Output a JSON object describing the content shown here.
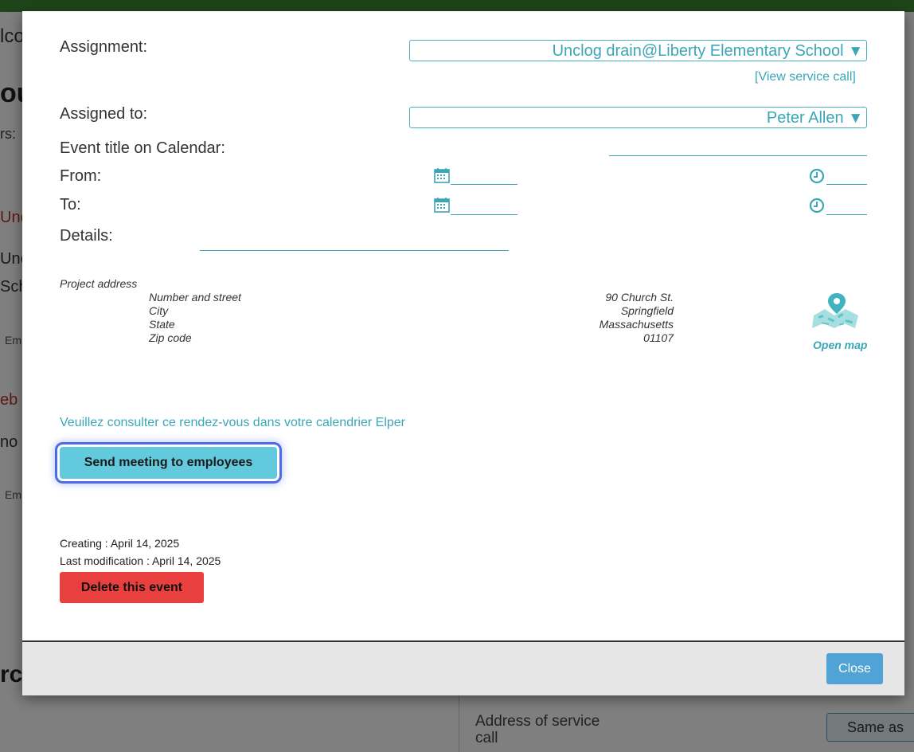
{
  "background": {
    "fragments": [
      "lco",
      "ou",
      "rs:",
      "Und",
      "Unc",
      "Sch",
      "Em",
      "eb",
      "no",
      "Em",
      "rc"
    ],
    "address_of_service_call": "Address of service call",
    "same_as_button": "Same as"
  },
  "modal": {
    "assignment": {
      "label": "Assignment:",
      "value": "Unclog drain@Liberty Elementary School",
      "view_link": "[View service call]"
    },
    "assigned_to": {
      "label": "Assigned to:",
      "value": "Peter Allen"
    },
    "event_title_label": "Event title on Calendar:",
    "from_label": "From:",
    "to_label": "To:",
    "details_label": "Details:",
    "project_address": {
      "heading": "Project address",
      "fields": [
        {
          "label": "Number and street",
          "value": "90 Church St."
        },
        {
          "label": "City",
          "value": "Springfield"
        },
        {
          "label": "State",
          "value": "Massachusetts"
        },
        {
          "label": "Zip code",
          "value": "01107"
        }
      ],
      "open_map": "Open map"
    },
    "consult_text": "Veuillez consulter ce rendez-vous dans votre calendrier Elper",
    "send_button": "Send meeting to employees",
    "created": "Creating : April 14, 2025",
    "modified": "Last modification : April 14, 2025",
    "delete_button": "Delete this event",
    "close_button": "Close"
  },
  "icons": {
    "dropdown_arrow": "▼",
    "calendar": "calendar-icon",
    "clock": "clock-icon",
    "map": "map-pin-icon"
  },
  "colors": {
    "accent": "#3aa7b8",
    "send_button": "#63c9dd",
    "focus_ring": "#4d6be6",
    "delete_button": "#ea3f3f",
    "close_button": "#4fa3d6",
    "topbar": "#3c8a32"
  }
}
